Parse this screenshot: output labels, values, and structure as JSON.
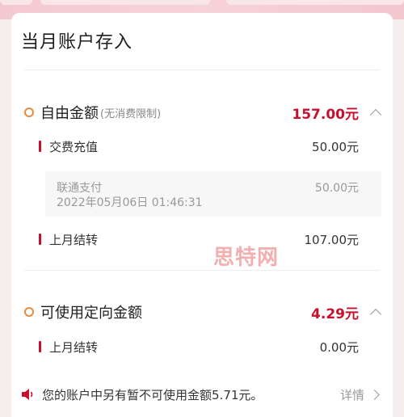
{
  "page": {
    "title": "当月账户存入"
  },
  "free_amount": {
    "label": "自由金额",
    "note": "(无消费限制)",
    "amount": "157.00元",
    "items": [
      {
        "label": "交费充值",
        "amount": "50.00元"
      },
      {
        "label": "上月结转",
        "amount": "107.00元"
      }
    ],
    "detail": {
      "name": "联通支付",
      "time": "2022年05月06日 01:46:31",
      "amount": "50.00元"
    }
  },
  "directed_amount": {
    "label": "可使用定向金额",
    "amount": "4.29元",
    "items": [
      {
        "label": "上月结转",
        "amount": "0.00元"
      }
    ]
  },
  "notice": {
    "text": "您的账户中另有暂不可使用金额5.71元。",
    "link": "详情"
  },
  "watermark": "思特网",
  "icons": {
    "section": "circle-ring-icon",
    "collapse": "chevron-up-icon",
    "speaker": "speaker-icon",
    "arrow": "chevron-right-icon"
  },
  "colors": {
    "accent_red": "#c8102e",
    "ring_orange": "#ea8a3d",
    "muted_gray": "#999999"
  }
}
